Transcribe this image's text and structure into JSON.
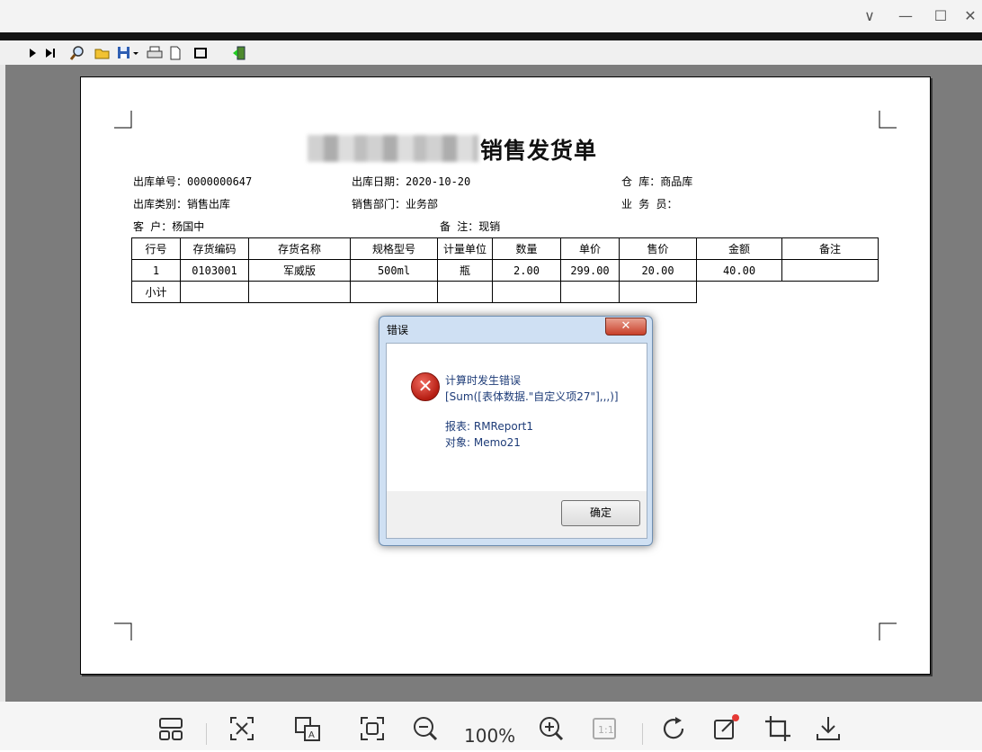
{
  "window": {
    "controls": [
      "∨",
      "—",
      "☐",
      "✕"
    ]
  },
  "toolbar": {
    "buttons": [
      "next-page",
      "last-page",
      "find",
      "open",
      "save",
      "print",
      "page-setup",
      "close-preview",
      "exit"
    ]
  },
  "document": {
    "title_suffix": "销售发货单",
    "header": {
      "row1": {
        "a": "出库单号：0000000647",
        "b": "出库日期：2020-10-20",
        "c": "仓    库：商品库"
      },
      "row2": {
        "a": "出库类别：销售出库",
        "b": "销售部门：业务部",
        "c": "业 务 员："
      },
      "row3": {
        "a": "客    户：杨国中",
        "b": "备    注：现销"
      }
    },
    "table": {
      "columns": [
        "行号",
        "存货编码",
        "存货名称",
        "规格型号",
        "计量单位",
        "数量",
        "单价",
        "售价",
        "金额",
        "备注"
      ],
      "rows": [
        [
          "1",
          "0103001",
          "军威版",
          "500ml",
          "瓶",
          "2.00",
          "299.00",
          "20.00",
          "40.00",
          ""
        ]
      ],
      "subtotal_label": "小计"
    }
  },
  "dialog": {
    "title": "错误",
    "close": "✕",
    "line1": "计算时发生错误",
    "line2": "[Sum([表体数据.\"自定义项27\"],,,)]",
    "line3": "报表: RMReport1",
    "line4": "对象: Memo21",
    "ok": "确定"
  },
  "viewer": {
    "zoom": "100%"
  }
}
